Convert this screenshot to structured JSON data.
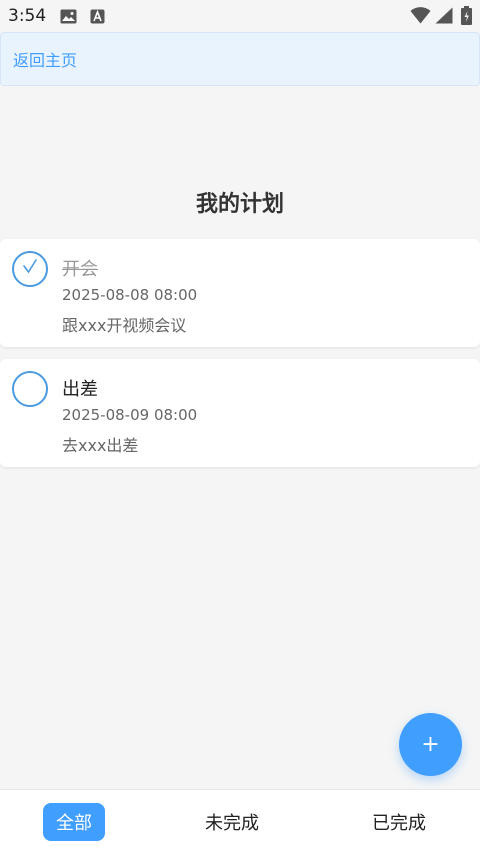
{
  "status_bar": {
    "time": "3:54",
    "icons": [
      "gallery-icon",
      "notification-a-icon",
      "wifi-icon",
      "signal-icon",
      "battery-icon"
    ]
  },
  "nav": {
    "back_label": "返回主页"
  },
  "page": {
    "title": "我的计划"
  },
  "plans": [
    {
      "name": "开会",
      "datetime": "2025-08-08 08:00",
      "description": "跟xxx开视频会议",
      "completed": true
    },
    {
      "name": "出差",
      "datetime": "2025-08-09 08:00",
      "description": "去xxx出差",
      "completed": false
    }
  ],
  "fab": {
    "label": "+"
  },
  "tabs": [
    {
      "label": "全部",
      "active": true
    },
    {
      "label": "未完成",
      "active": false
    },
    {
      "label": "已完成",
      "active": false
    }
  ],
  "colors": {
    "accent": "#409eff",
    "background": "#f5f5f5",
    "back_bar_bg": "#e9f3fe"
  }
}
